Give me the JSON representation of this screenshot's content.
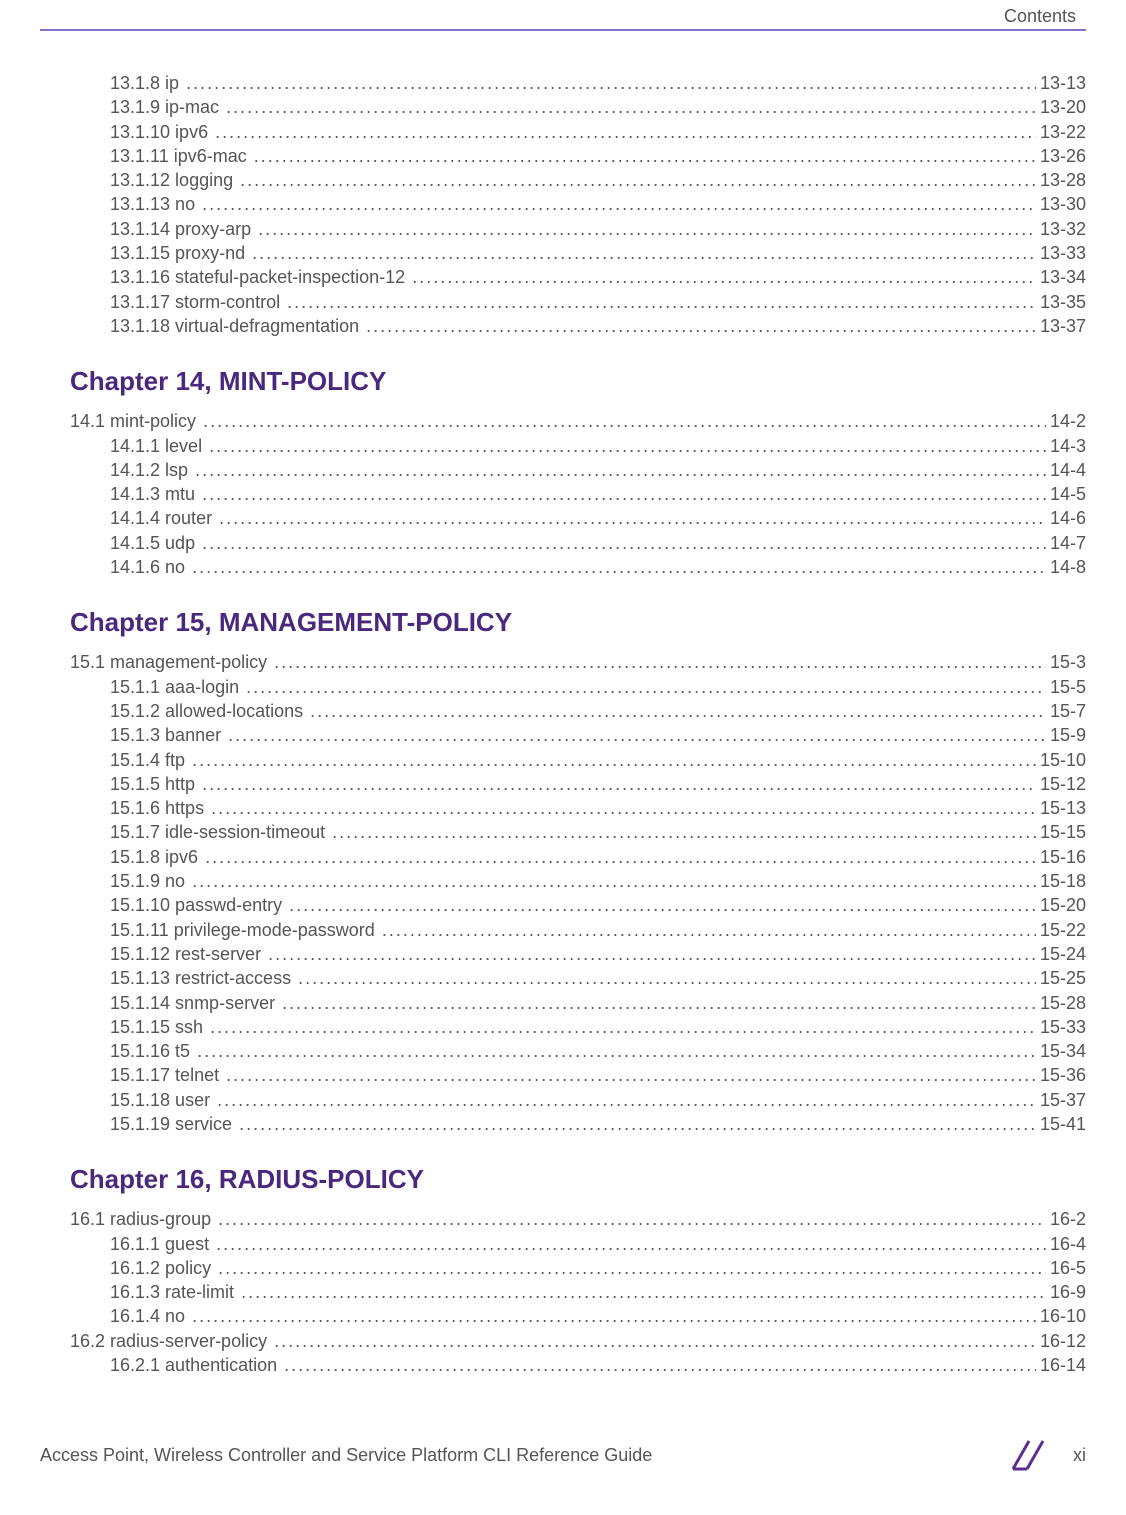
{
  "header": {
    "title": "Contents"
  },
  "footer": {
    "left": "Access Point, Wireless Controller and Service Platform CLI Reference Guide",
    "pageNumber": "xi"
  },
  "continuation": [
    {
      "num": "13.1.8",
      "label": "ip",
      "page": "13-13"
    },
    {
      "num": "13.1.9",
      "label": "ip-mac",
      "page": "13-20"
    },
    {
      "num": "13.1.10",
      "label": "ipv6",
      "page": "13-22"
    },
    {
      "num": "13.1.11",
      "label": "ipv6-mac",
      "page": "13-26"
    },
    {
      "num": "13.1.12",
      "label": "logging",
      "page": "13-28"
    },
    {
      "num": "13.1.13",
      "label": "no",
      "page": "13-30"
    },
    {
      "num": "13.1.14",
      "label": "proxy-arp",
      "page": "13-32"
    },
    {
      "num": "13.1.15",
      "label": "proxy-nd",
      "page": "13-33"
    },
    {
      "num": "13.1.16",
      "label": "stateful-packet-inspection-12",
      "page": "13-34"
    },
    {
      "num": "13.1.17",
      "label": "storm-control",
      "page": "13-35"
    },
    {
      "num": "13.1.18",
      "label": "virtual-defragmentation",
      "page": "13-37"
    }
  ],
  "chapters": [
    {
      "heading": "Chapter 14, MINT-POLICY",
      "entries": [
        {
          "level": 1,
          "num": "14.1",
          "label": "mint-policy",
          "page": "14-2"
        },
        {
          "level": 2,
          "num": "14.1.1",
          "label": "level",
          "page": "14-3"
        },
        {
          "level": 2,
          "num": "14.1.2",
          "label": "lsp",
          "page": "14-4"
        },
        {
          "level": 2,
          "num": "14.1.3",
          "label": "mtu",
          "page": "14-5"
        },
        {
          "level": 2,
          "num": "14.1.4",
          "label": "router",
          "page": "14-6"
        },
        {
          "level": 2,
          "num": "14.1.5",
          "label": "udp",
          "page": "14-7"
        },
        {
          "level": 2,
          "num": "14.1.6",
          "label": "no",
          "page": "14-8"
        }
      ]
    },
    {
      "heading": "Chapter 15, MANAGEMENT-POLICY",
      "entries": [
        {
          "level": 1,
          "num": "15.1",
          "label": "management-policy",
          "page": "15-3"
        },
        {
          "level": 2,
          "num": "15.1.1",
          "label": "aaa-login",
          "page": "15-5"
        },
        {
          "level": 2,
          "num": "15.1.2",
          "label": "allowed-locations",
          "page": "15-7"
        },
        {
          "level": 2,
          "num": "15.1.3",
          "label": "banner",
          "page": "15-9"
        },
        {
          "level": 2,
          "num": "15.1.4",
          "label": "ftp",
          "page": "15-10"
        },
        {
          "level": 2,
          "num": "15.1.5",
          "label": "http",
          "page": "15-12"
        },
        {
          "level": 2,
          "num": "15.1.6",
          "label": "https",
          "page": "15-13"
        },
        {
          "level": 2,
          "num": "15.1.7",
          "label": "idle-session-timeout",
          "page": "15-15"
        },
        {
          "level": 2,
          "num": "15.1.8",
          "label": "ipv6",
          "page": "15-16"
        },
        {
          "level": 2,
          "num": "15.1.9",
          "label": "no",
          "page": "15-18"
        },
        {
          "level": 2,
          "num": "15.1.10",
          "label": "passwd-entry",
          "page": "15-20"
        },
        {
          "level": 2,
          "num": "15.1.11",
          "label": "privilege-mode-password",
          "page": "15-22"
        },
        {
          "level": 2,
          "num": "15.1.12",
          "label": "rest-server",
          "page": "15-24"
        },
        {
          "level": 2,
          "num": "15.1.13",
          "label": "restrict-access",
          "page": "15-25"
        },
        {
          "level": 2,
          "num": "15.1.14",
          "label": "snmp-server",
          "page": "15-28"
        },
        {
          "level": 2,
          "num": "15.1.15",
          "label": "ssh",
          "page": "15-33"
        },
        {
          "level": 2,
          "num": "15.1.16",
          "label": "t5",
          "page": "15-34"
        },
        {
          "level": 2,
          "num": "15.1.17",
          "label": "telnet",
          "page": "15-36"
        },
        {
          "level": 2,
          "num": "15.1.18",
          "label": "user",
          "page": "15-37"
        },
        {
          "level": 2,
          "num": "15.1.19",
          "label": "service",
          "page": "15-41"
        }
      ]
    },
    {
      "heading": "Chapter 16, RADIUS-POLICY",
      "entries": [
        {
          "level": 1,
          "num": "16.1",
          "label": "radius-group",
          "page": "16-2"
        },
        {
          "level": 2,
          "num": "16.1.1",
          "label": "guest",
          "page": "16-4"
        },
        {
          "level": 2,
          "num": "16.1.2",
          "label": "policy",
          "page": "16-5"
        },
        {
          "level": 2,
          "num": "16.1.3",
          "label": "rate-limit",
          "page": "16-9"
        },
        {
          "level": 2,
          "num": "16.1.4",
          "label": "no",
          "page": "16-10"
        },
        {
          "level": 1,
          "num": "16.2",
          "label": "radius-server-policy",
          "page": "16-12"
        },
        {
          "level": 2,
          "num": "16.2.1",
          "label": "authentication",
          "page": "16-14"
        }
      ]
    }
  ]
}
